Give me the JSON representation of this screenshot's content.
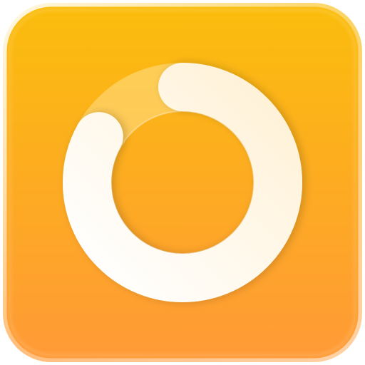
{
  "icon": {
    "name": "progress-ring-app-icon",
    "progress_fraction": 0.83,
    "colors": {
      "background_top": "#FBBD0C",
      "background_bottom": "#FF9A37",
      "ring": "#FFF7E6",
      "track": "#FFE08A"
    }
  }
}
